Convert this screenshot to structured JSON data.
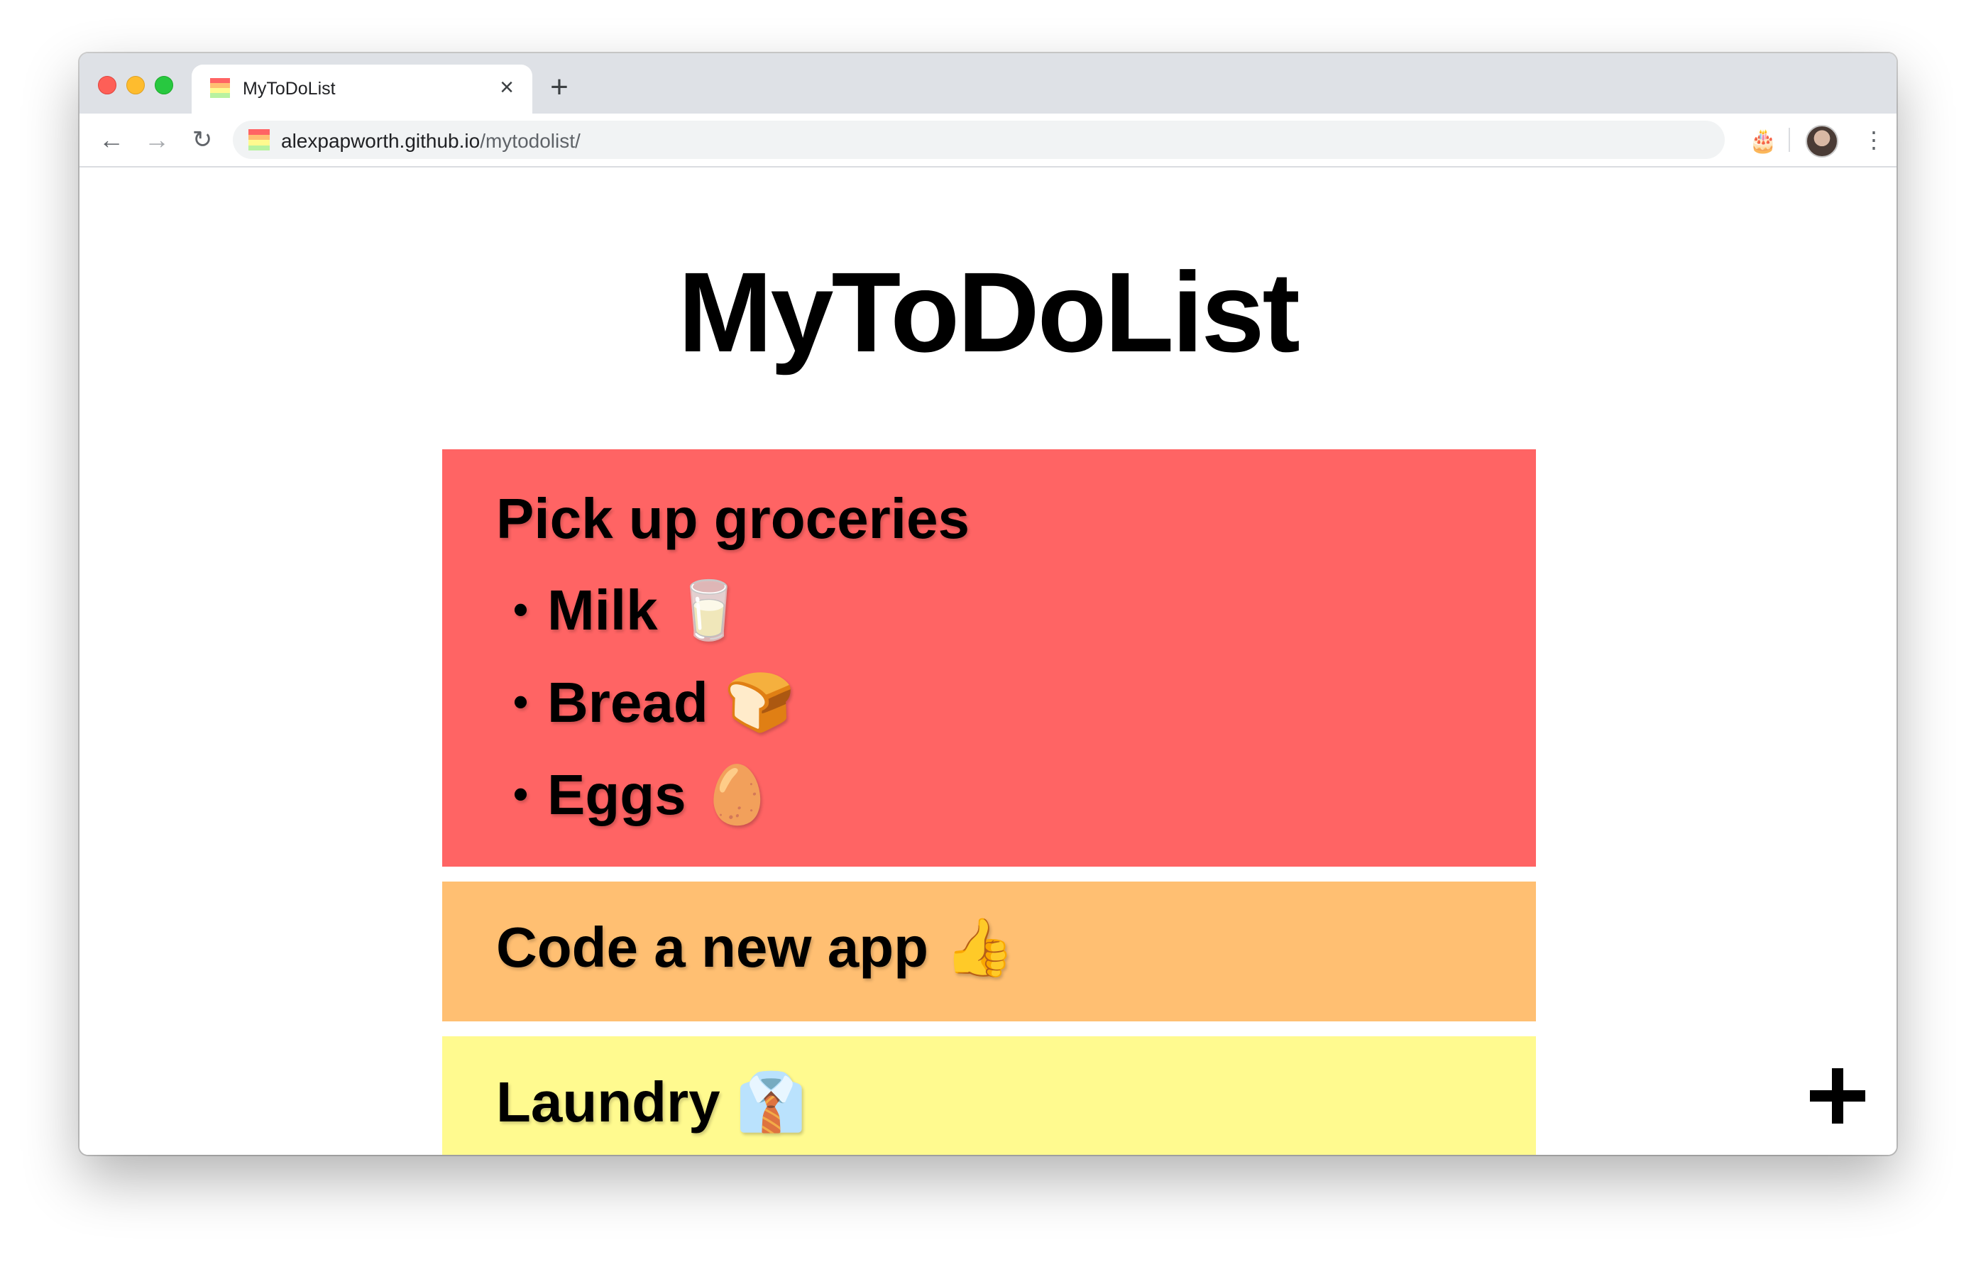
{
  "browser": {
    "tab": {
      "title": "MyToDoList",
      "close_glyph": "×"
    },
    "new_tab_glyph": "+",
    "nav": {
      "back_glyph": "←",
      "forward_glyph": "→",
      "reload_glyph": "↻"
    },
    "address": {
      "host": "alexpapworth.github.io",
      "path": "/mytodolist/"
    },
    "extension_icon": "🎂",
    "menu_glyph": "⋮",
    "favicon_colors": [
      "#ff6464",
      "#ffbf72",
      "#fffa8f",
      "#b8f2a0"
    ]
  },
  "page": {
    "title": "MyToDoList",
    "todos": [
      {
        "title": "Pick up groceries",
        "color": "#ff6464",
        "items": [
          {
            "bullet": "•",
            "label": "Milk 🥛"
          },
          {
            "bullet": "•",
            "label": "Bread 🍞"
          },
          {
            "bullet": "•",
            "label": "Eggs 🥚"
          }
        ]
      },
      {
        "title": "Code a new app 👍",
        "color": "#ffbf72"
      },
      {
        "title": "Laundry 👔",
        "color": "#fffa8f"
      }
    ],
    "add_button_icon": "plus-icon"
  }
}
